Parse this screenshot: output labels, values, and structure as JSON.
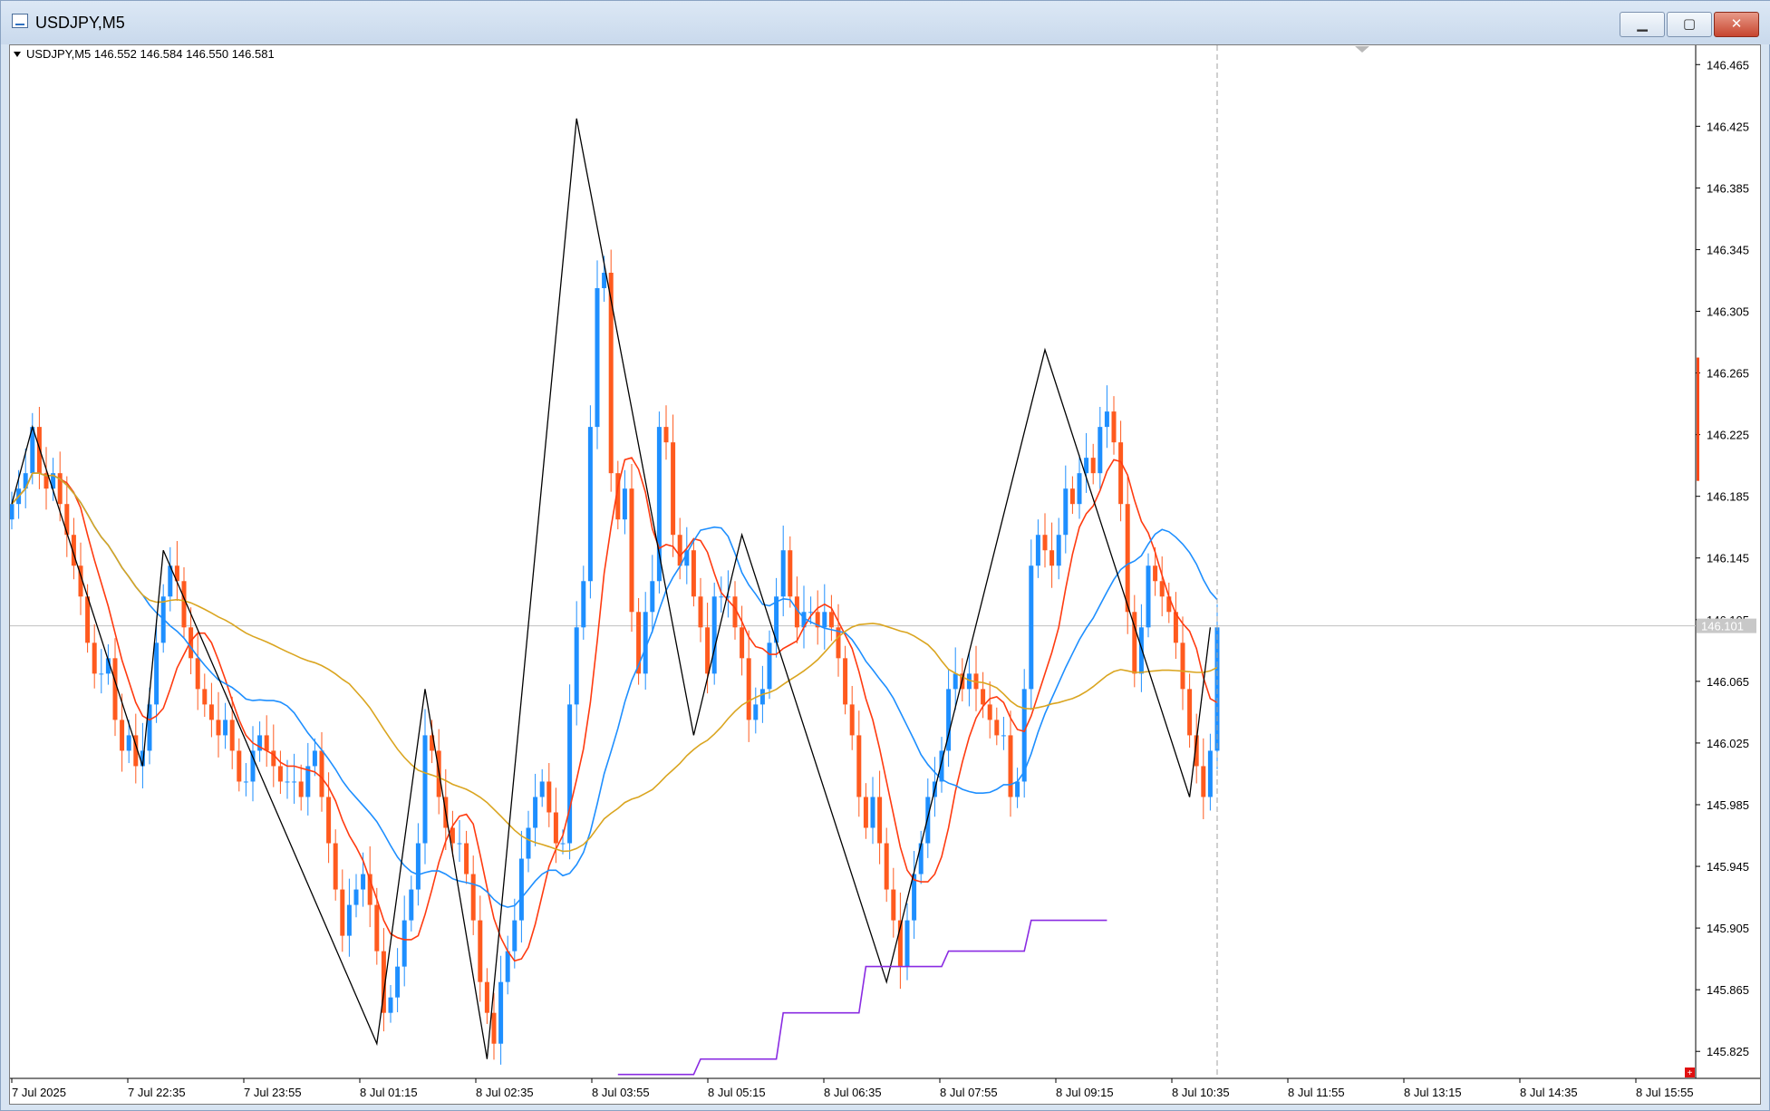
{
  "window": {
    "title": "USDJPY,M5",
    "minimize_glyph": "▁",
    "maximize_glyph": "▢",
    "close_glyph": "✕"
  },
  "chart_header": {
    "text": "USDJPY,M5  146.552 146.584 146.550 146.581"
  },
  "chart_data": {
    "type": "candlestick",
    "symbol": "USDJPY",
    "timeframe": "M5",
    "y_axis": {
      "ticks": [
        "146.465",
        "146.425",
        "146.385",
        "146.345",
        "146.305",
        "146.265",
        "146.225",
        "146.185",
        "146.145",
        "146.105",
        "146.065",
        "146.025",
        "145.985",
        "145.945",
        "145.905",
        "145.865",
        "145.825"
      ],
      "range": [
        145.8075,
        146.4775
      ]
    },
    "x_axis": {
      "ticks": [
        "7 Jul 2025",
        "7 Jul 22:35",
        "7 Jul 23:55",
        "8 Jul 01:15",
        "8 Jul 02:35",
        "8 Jul 03:55",
        "8 Jul 05:15",
        "8 Jul 06:35",
        "8 Jul 07:55",
        "8 Jul 09:15",
        "8 Jul 10:35",
        "8 Jul 11:55",
        "8 Jul 13:15",
        "8 Jul 14:35",
        "8 Jul 15:55"
      ]
    },
    "current_price_label": "146.101",
    "current_price": 146.101,
    "candles_close": [
      146.18,
      146.19,
      146.2,
      146.23,
      146.2,
      146.19,
      146.2,
      146.18,
      146.16,
      146.14,
      146.12,
      146.09,
      146.07,
      146.07,
      146.08,
      146.04,
      146.02,
      146.03,
      146.01,
      146.02,
      146.05,
      146.09,
      146.12,
      146.14,
      146.13,
      146.1,
      146.08,
      146.06,
      146.05,
      146.04,
      146.03,
      146.04,
      146.02,
      146.0,
      146.0,
      146.02,
      146.03,
      146.02,
      146.01,
      146.0,
      146.0,
      146.0,
      145.99,
      146.01,
      146.02,
      145.99,
      145.96,
      145.93,
      145.9,
      145.92,
      145.93,
      145.94,
      145.92,
      145.89,
      145.85,
      145.86,
      145.88,
      145.91,
      145.93,
      145.96,
      146.03,
      146.02,
      145.99,
      145.97,
      145.96,
      145.96,
      145.94,
      145.91,
      145.87,
      145.85,
      145.83,
      145.87,
      145.89,
      145.91,
      145.95,
      145.97,
      145.99,
      146.0,
      145.98,
      145.96,
      145.96,
      146.05,
      146.1,
      146.13,
      146.23,
      146.32,
      146.33,
      146.2,
      146.17,
      146.19,
      146.11,
      146.07,
      146.11,
      146.13,
      146.23,
      146.22,
      146.16,
      146.14,
      146.15,
      146.12,
      146.1,
      146.07,
      146.12,
      146.12,
      146.12,
      146.1,
      146.08,
      146.04,
      146.05,
      146.06,
      146.09,
      146.12,
      146.15,
      146.12,
      146.1,
      146.11,
      146.11,
      146.1,
      146.11,
      146.1,
      146.08,
      146.05,
      146.03,
      145.99,
      145.97,
      145.99,
      145.96,
      145.93,
      145.91,
      145.88,
      145.91,
      145.94,
      145.96,
      145.99,
      146.0,
      146.02,
      146.06,
      146.07,
      146.06,
      146.07,
      146.06,
      146.05,
      146.04,
      146.03,
      146.03,
      145.99,
      146.0,
      146.06,
      146.14,
      146.16,
      146.15,
      146.14,
      146.16,
      146.19,
      146.18,
      146.2,
      146.21,
      146.2,
      146.23,
      146.24,
      146.22,
      146.18,
      146.11,
      146.07,
      146.1,
      146.14,
      146.13,
      146.12,
      146.11,
      146.09,
      146.06,
      146.03,
      146.01,
      145.99,
      146.02,
      146.1
    ],
    "series": [
      {
        "name": "",
        "color": "#ff3b10",
        "type": "moving_average"
      },
      {
        "name": "",
        "color": "#1e8fff",
        "type": "moving_average"
      },
      {
        "name": "",
        "color": "#daa520",
        "type": "moving_average"
      },
      {
        "name": "",
        "color": "#000000",
        "type": "zigzag",
        "points": [
          [
            146.18,
            0
          ],
          [
            146.23,
            3
          ],
          [
            146.01,
            19
          ],
          [
            146.15,
            22
          ],
          [
            145.83,
            53
          ],
          [
            146.06,
            60
          ],
          [
            145.82,
            69
          ],
          [
            146.43,
            82
          ],
          [
            146.03,
            99
          ],
          [
            146.16,
            106
          ],
          [
            145.87,
            127
          ],
          [
            146.28,
            150
          ],
          [
            145.99,
            171
          ],
          [
            146.1,
            174
          ]
        ]
      },
      {
        "name": "",
        "color": "#8a2be2",
        "type": "step_line",
        "values": [
          145.81,
          145.82,
          145.85,
          145.88,
          145.89,
          145.91
        ]
      }
    ],
    "up_color": "#1e8fff",
    "down_color": "#ff5a1e"
  }
}
